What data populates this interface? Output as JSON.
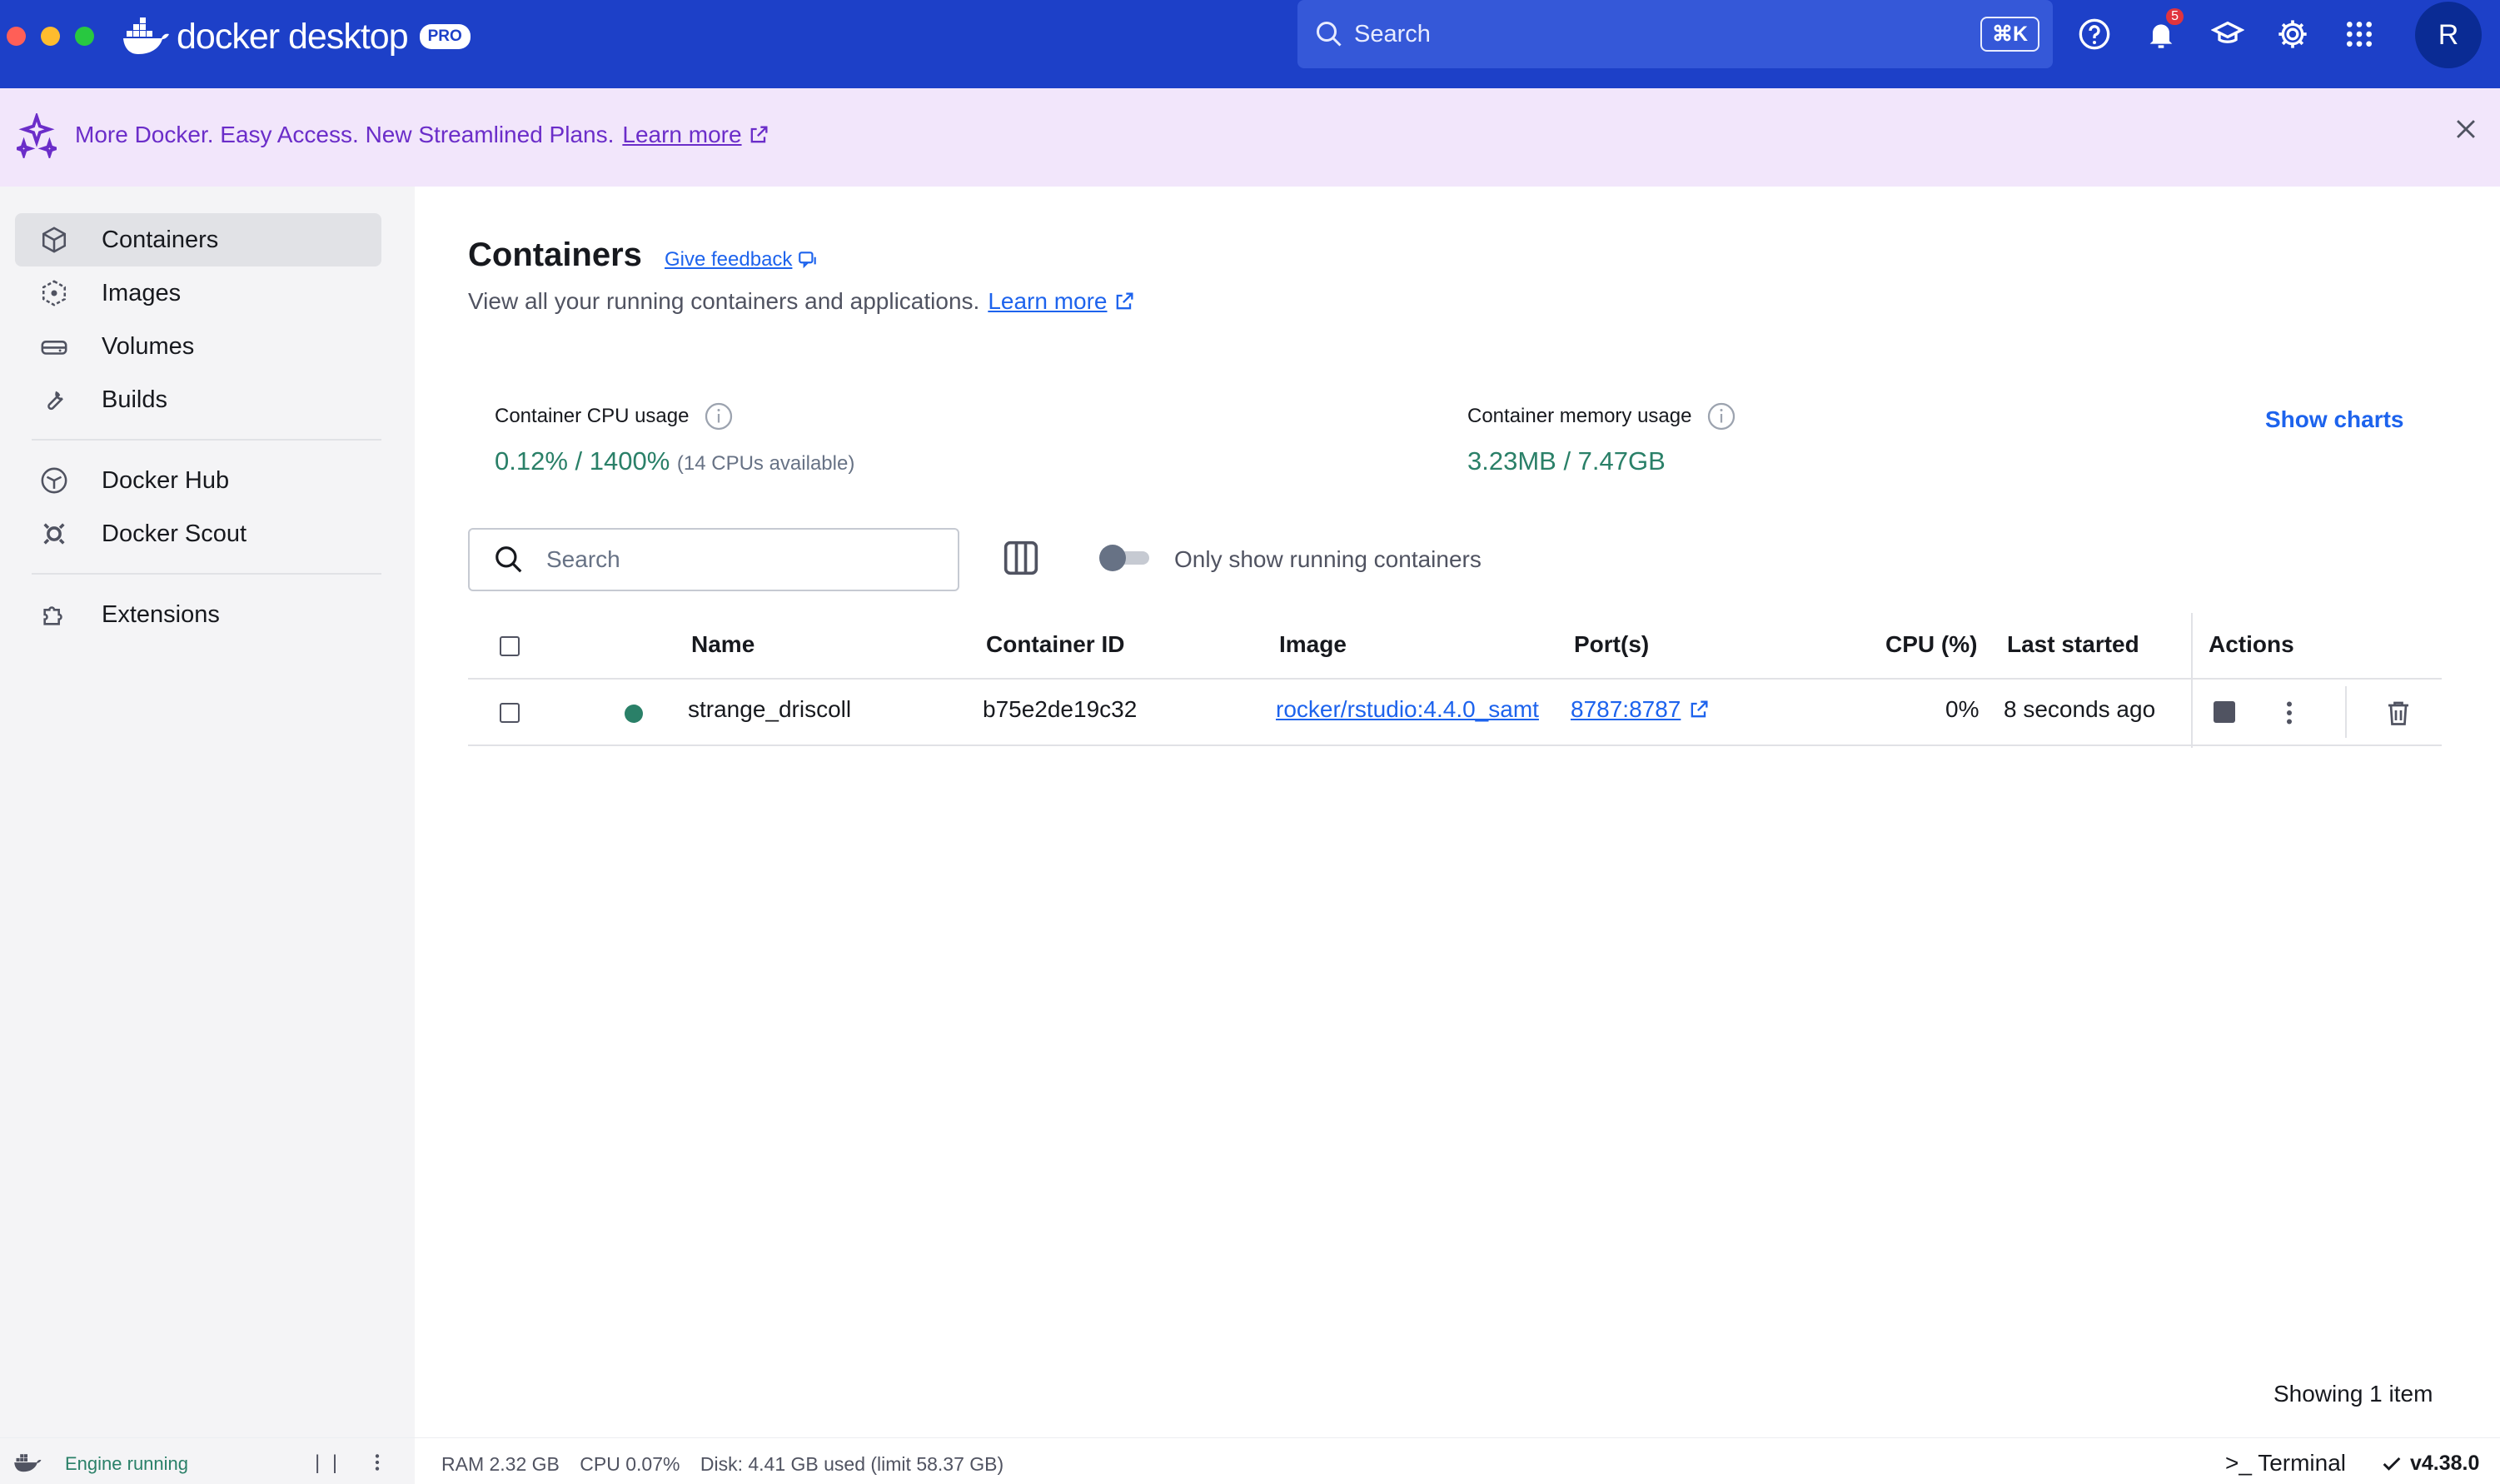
{
  "app": {
    "brand_name": "docker desktop",
    "pro_badge": "PRO",
    "accent_color": "#1d40c8"
  },
  "topbar": {
    "search_placeholder": "Search",
    "shortcut": "⌘K",
    "notifications_count": "5",
    "avatar_initial": "R",
    "icons": [
      "help-icon",
      "bell-icon",
      "learn-icon",
      "gear-icon",
      "apps-grid-icon"
    ]
  },
  "banner": {
    "text": "More Docker. Easy Access. New Streamlined Plans.",
    "link": "Learn more"
  },
  "sidebar": {
    "items": [
      {
        "label": "Containers",
        "icon": "container-icon",
        "active": true
      },
      {
        "label": "Images",
        "icon": "images-icon",
        "active": false
      },
      {
        "label": "Volumes",
        "icon": "volumes-icon",
        "active": false
      },
      {
        "label": "Builds",
        "icon": "wrench-icon",
        "active": false
      },
      {
        "label": "Docker Hub",
        "icon": "hub-icon",
        "active": false
      },
      {
        "label": "Docker Scout",
        "icon": "scout-icon",
        "active": false
      },
      {
        "label": "Extensions",
        "icon": "puzzle-icon",
        "active": false
      }
    ]
  },
  "main": {
    "title": "Containers",
    "feedback": "Give feedback",
    "subtitle": "View all your running containers and applications.",
    "subtitle_link": "Learn more",
    "cpu_label": "Container CPU usage",
    "cpu_value": "0.12% / 1400%",
    "cpu_note": "(14 CPUs available)",
    "mem_label": "Container memory usage",
    "mem_value": "3.23MB / 7.47GB",
    "show_charts": "Show charts",
    "search_placeholder": "Search",
    "toggle_label": "Only show running containers",
    "toggle_on": false,
    "columns": [
      "Name",
      "Container ID",
      "Image",
      "Port(s)",
      "CPU (%)",
      "Last started",
      "Actions"
    ],
    "rows": [
      {
        "status": "running",
        "name": "strange_driscoll",
        "container_id": "b75e2de19c32",
        "image": "rocker/rstudio:4.4.0_samt",
        "ports": "8787:8787",
        "cpu": "0%",
        "last_started": "8 seconds ago"
      }
    ],
    "showing": "Showing 1 item"
  },
  "footer": {
    "engine_status": "Engine running",
    "ram": "RAM 2.32 GB",
    "cpu": "CPU 0.07%",
    "disk": "Disk: 4.41 GB used (limit 58.37 GB)",
    "terminal": ">_ Terminal",
    "version": "v4.38.0"
  }
}
